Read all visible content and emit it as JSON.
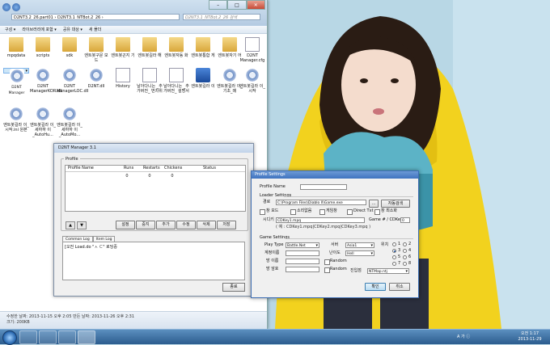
{
  "explorer": {
    "address": "D2NT3.2_26.part01 › D2NT3.1_NTBot.2_26 ›",
    "search_placeholder": "D2NT3.1_NTBot.2_26 검색",
    "toolbar": [
      "구성 ▾",
      "라이브러리에 포함 ▾",
      "공유 대상 ▾",
      "새 폴더"
    ],
    "files_row1": [
      "mpqdata",
      "scripts",
      "sdk",
      "엔트봇구문 모드",
      "엔트봇곤지 기",
      "엔트봇길라 해",
      "엔트봇자동 화",
      "엔트봇통합 게",
      "엔트봇자기 어",
      "D2NT Manager.cfg"
    ],
    "files_row2": [
      "D2NT Manager",
      "D2NT ManagerKOR.dll",
      "D2NT ManagerLOC.dll",
      "D2NT.dll",
      "History",
      "날아다니는 _추가버전_ 번차위",
      "날아다니는 _추가버전_ 설명서",
      "엔트봇길라 이",
      "엔트봇길라 이_기초_매",
      "엔트봇길라 이_시작"
    ],
    "files_row3": [
      "엔트봇길라 이_시작.ini 원본",
      "엔트봇길라 이_세하하 이 _AutoHu...",
      "엔트봇길라 이_세하하 이 _AutoMo..."
    ],
    "status_line1": "수정한 날짜: 2013-11-15 오후 2:05    만든 날짜: 2013-11-26 오후 2:31",
    "status_line2": "크기: 200KB"
  },
  "manager": {
    "title": "D2NT Manager 3.1",
    "profile_group": "Profile",
    "columns": [
      "Profile Name",
      "Runs",
      "Restarts",
      "Chickens",
      "Status"
    ],
    "row": [
      "",
      "0",
      "0",
      "0",
      ""
    ],
    "buttons": [
      "설정",
      "중지",
      "추가",
      "수정",
      "삭제",
      "저장"
    ],
    "up": "▲",
    "down": "▼",
    "log_tabs": [
      "Common Log",
      "Item Log"
    ],
    "log_line": "[오전 Load.do  \"ㅅ     ㄷ\" 로딩중",
    "close": "종료"
  },
  "profile_settings": {
    "title": "Profile Settings",
    "profile_name_label": "Profile Name",
    "profile_name_value": "",
    "loader_label": "Loader Settings",
    "path_label": "경로",
    "path_value": "C:\\Program Files\\Diablo II\\Game.exe",
    "browse": "...",
    "auto_detect": "자동검색",
    "options": [
      "창 모드",
      "소리없음",
      "게임창",
      "Direct Txt",
      "창 최소화"
    ],
    "key_label": "시디키",
    "key_value": "CDKey1.mpq",
    "game_key_label": "Game # / CDKey",
    "game_key_value": "0",
    "key_example": "( 예 : CDKey1.mpq|CDKey2.mpq|CDKey3.mpq )",
    "game_settings_label": "Game Settings",
    "play_type_label": "Play Type",
    "play_type_value": "Battle.Net",
    "server_label": "서버",
    "server_value": "Asia1",
    "account_label": "계정이름",
    "difficulty_label": "난이도",
    "difficulty_value": "Hell",
    "room_label": "방 이름",
    "room_pw_label": "방 암호",
    "random1": "Random",
    "random2": "Random",
    "position_label": "위치",
    "positions": [
      "1",
      "2",
      "3",
      "4",
      "5",
      "6",
      "7",
      "8"
    ],
    "entry_label": "진입점",
    "entry_value": "NTMap.ntj",
    "ok": "확인",
    "cancel": "취소"
  },
  "taskbar": {
    "tray": "A 가 ⓘ",
    "time": "오전 1:17",
    "date": "2013-11-29"
  }
}
